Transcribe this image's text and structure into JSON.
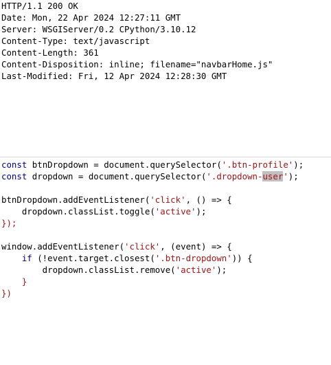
{
  "response": {
    "headers": [
      "HTTP/1.1 200 OK",
      "Date: Mon, 22 Apr 2024 12:27:11 GMT",
      "Server: WSGIServer/0.2 CPython/3.10.12",
      "Content-Type: text/javascript",
      "Content-Length: 361",
      "Content-Disposition: inline; filename=\"navbarHome.js\"",
      "Last-Modified: Fri, 12 Apr 2024 12:28:30 GMT"
    ]
  },
  "code": {
    "l1": {
      "kw": "const",
      "a": " btnDropdown = document.querySelector(",
      "s": "'.btn-profile'",
      "b": ");"
    },
    "l2": {
      "kw": "const",
      "a": " dropdown = document.querySelector(",
      "s1": "'.dropdown-",
      "hl": "user",
      "s2": "'",
      "b": ");"
    },
    "l4": {
      "a": "btnDropdown.addEventListener(",
      "s": "'click'",
      "b": ", () => {"
    },
    "l5": {
      "a": "    dropdown.classList.toggle(",
      "s": "'active'",
      "b": ");"
    },
    "l6": {
      "p": "});"
    },
    "l8": {
      "a": "window.addEventListener(",
      "s": "'click'",
      "b": ", (event) => {"
    },
    "l9": {
      "ind": "    ",
      "kw": "if",
      "a": " (!event.target.closest(",
      "s": "'.btn-dropdown'",
      "b": ")) {"
    },
    "l10": {
      "a": "        dropdown.classList.remove(",
      "s": "'active'",
      "b": ");"
    },
    "l11": {
      "p": "    }"
    },
    "l12": {
      "p": "})"
    }
  }
}
